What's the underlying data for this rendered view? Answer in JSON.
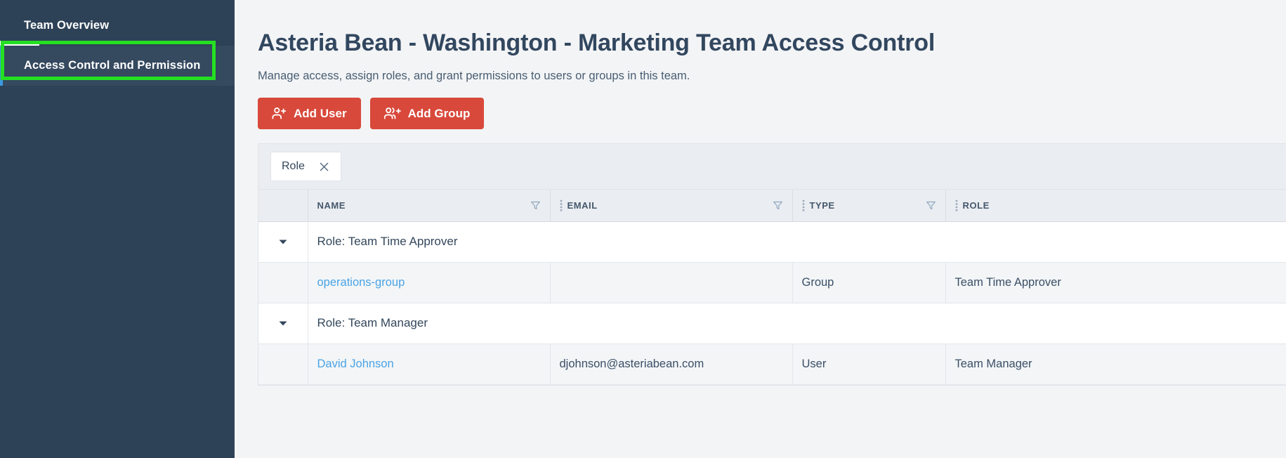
{
  "sidebar": {
    "items": [
      {
        "label": "Team Overview",
        "active": false
      },
      {
        "label": "Access Control and Permission",
        "active": true
      }
    ],
    "highlight_color": "#25e022",
    "background_color": "#2e4257",
    "active_accent_color": "#3b9ae1"
  },
  "header": {
    "title": "Asteria Bean - Washington - Marketing Team Access Control",
    "subtitle": "Manage access, assign roles, and grant permissions to users or groups in this team."
  },
  "toolbar": {
    "add_user_label": "Add User",
    "add_group_label": "Add Group",
    "button_color": "#d8493b"
  },
  "filters": {
    "chips": [
      {
        "label": "Role",
        "remove_icon": "close-icon"
      }
    ]
  },
  "table": {
    "columns": [
      {
        "key": "caret",
        "label": "",
        "has_grip": false,
        "has_filter": false
      },
      {
        "key": "name",
        "label": "NAME",
        "has_grip": false,
        "has_filter": true
      },
      {
        "key": "email",
        "label": "EMAIL",
        "has_grip": true,
        "has_filter": true
      },
      {
        "key": "type",
        "label": "TYPE",
        "has_grip": true,
        "has_filter": true
      },
      {
        "key": "role",
        "label": "ROLE",
        "has_grip": true,
        "has_filter": false
      }
    ],
    "rows": [
      {
        "kind": "group",
        "caret": "expanded",
        "label": "Role: Team Time Approver"
      },
      {
        "kind": "data",
        "name": "operations-group",
        "name_is_link": true,
        "email": "",
        "type": "Group",
        "role": "Team Time Approver"
      },
      {
        "kind": "group",
        "caret": "expanded",
        "label": "Role: Team Manager"
      },
      {
        "kind": "data",
        "name": "David Johnson",
        "name_is_link": true,
        "email": "djohnson@asteriabean.com",
        "type": "User",
        "role": "Team Manager"
      }
    ],
    "link_color": "#4aa3e4"
  }
}
